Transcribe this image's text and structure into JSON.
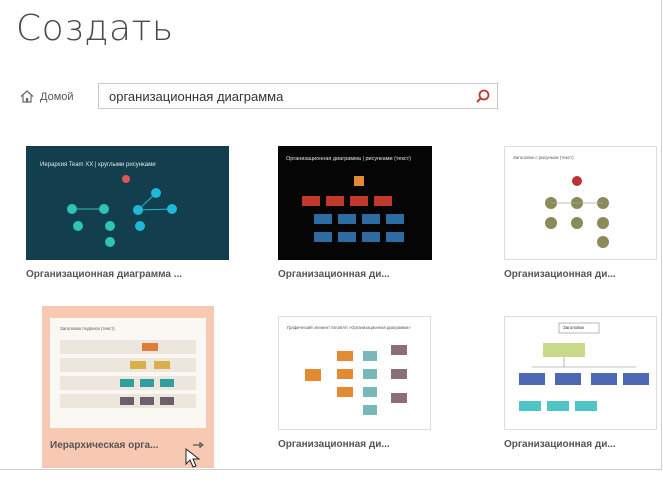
{
  "page": {
    "title": "Создать"
  },
  "breadcrumb": {
    "home_label": "Домой"
  },
  "search": {
    "value": "организационная диаграмма"
  },
  "templates": [
    {
      "caption": "Организационная диаграмма ...",
      "thumb_heading": "Иерархия Team XX | круглыми рисунками",
      "thumb_bg": "#123e4d"
    },
    {
      "caption": "Организационная ди...",
      "thumb_heading": "Организационная диаграмма | рисунками (текст)",
      "thumb_bg": "#050505"
    },
    {
      "caption": "Организационная ди...",
      "thumb_heading": "Заголовок с рисунком (текст)",
      "thumb_bg": "#ffffff"
    },
    {
      "caption": "Иерархическая орга...",
      "thumb_heading": "Заголовок подписи (текст)",
      "thumb_bg": "#fbf7f2",
      "selected": true
    },
    {
      "caption": "Организационная ди...",
      "thumb_heading": "Графический элемент SmartArt «Организационная диаграмма»",
      "thumb_bg": "#ffffff"
    },
    {
      "caption": "Организационная ди...",
      "thumb_heading": "Заголовок",
      "thumb_bg": "#ffffff"
    }
  ],
  "colors": {
    "selected_tile": "#f7c9b2",
    "teal": "#2ec4b6",
    "cyan": "#1fb8d8",
    "red": "#c0392b",
    "blue": "#2d6ca2",
    "olive": "#8b8a5a",
    "orange": "#e38a33"
  },
  "icons": {
    "home": "home-icon",
    "search": "search-icon",
    "pin": "pin-icon",
    "cursor": "mouse-cursor-icon"
  }
}
